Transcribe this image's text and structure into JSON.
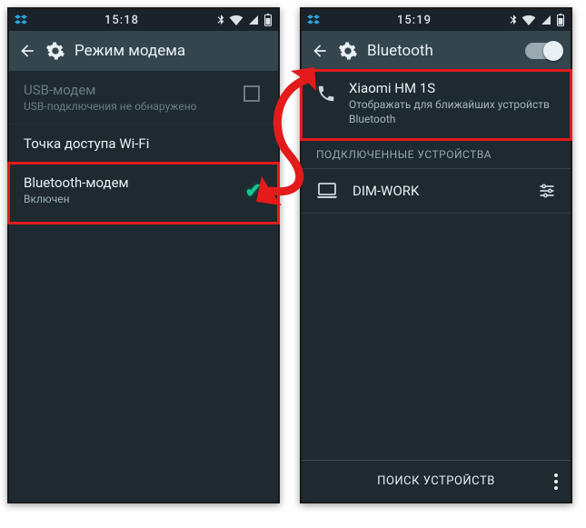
{
  "left": {
    "statusbar": {
      "clock": "15:18"
    },
    "appbar": {
      "title": "Режим модема"
    },
    "usb": {
      "title": "USB-модем",
      "sub": "USB-подключения не обнаружено"
    },
    "wifi_ap": {
      "title": "Точка доступа Wi-Fi"
    },
    "bt_tether": {
      "title": "Bluetooth-модем",
      "sub": "Включен"
    }
  },
  "right": {
    "statusbar": {
      "clock": "15:19"
    },
    "appbar": {
      "title": "Bluetooth"
    },
    "device_visible": {
      "title": "Xiaomi HM 1S",
      "sub": "Отображать для ближайших устройств Bluetooth"
    },
    "section_paired": "ПОДКЛЮЧЕННЫЕ УСТРОЙСТВА",
    "paired_device": {
      "name": "DIM-WORK"
    },
    "bottom_action": "ПОИСК УСТРОЙСТВ"
  }
}
